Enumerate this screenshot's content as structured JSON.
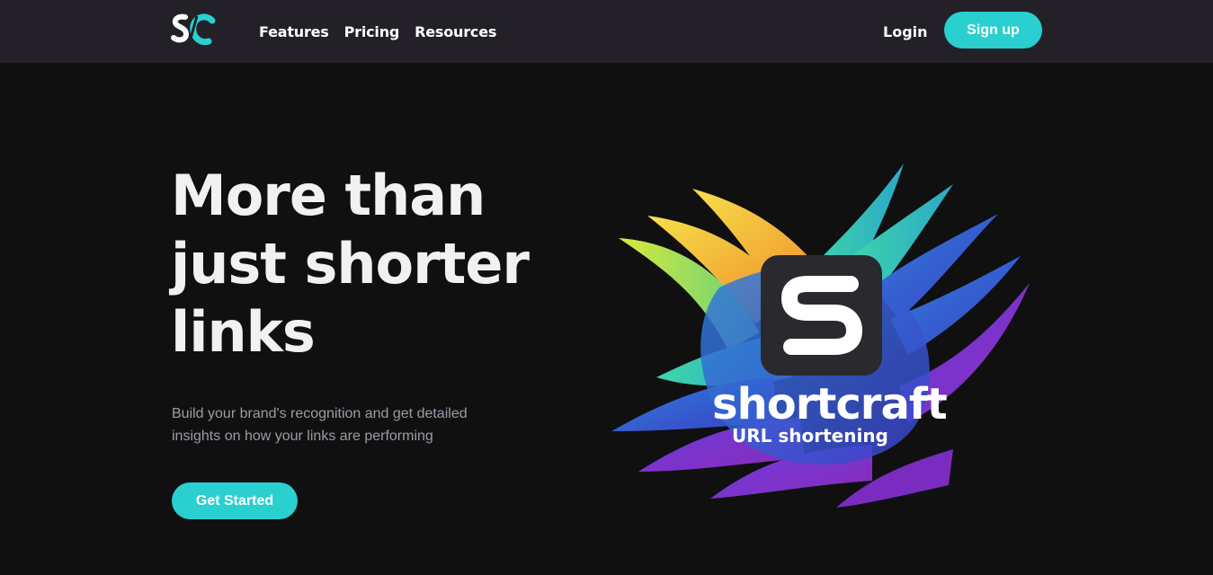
{
  "nav": {
    "logo_icon": "sc-logo-icon",
    "links": [
      {
        "label": "Features"
      },
      {
        "label": "Pricing"
      },
      {
        "label": "Resources"
      }
    ],
    "login_label": "Login",
    "signup_label": "Sign up"
  },
  "hero": {
    "title_lines": [
      "More than",
      "just shorter",
      "links"
    ],
    "description_lines": [
      "Build your brand's recognition and get detailed",
      "insights on how your links are performing"
    ],
    "cta_label": "Get Started",
    "image": {
      "icon": "shortcraft-s-icon",
      "brand": "shortcraft",
      "tagline": "URL shortening"
    }
  },
  "colors": {
    "accent": "#2acfcf",
    "nav_bg": "#232127",
    "page_bg": "#101011",
    "heading": "#f1f1f1",
    "body_text": "#9e9aa7"
  }
}
